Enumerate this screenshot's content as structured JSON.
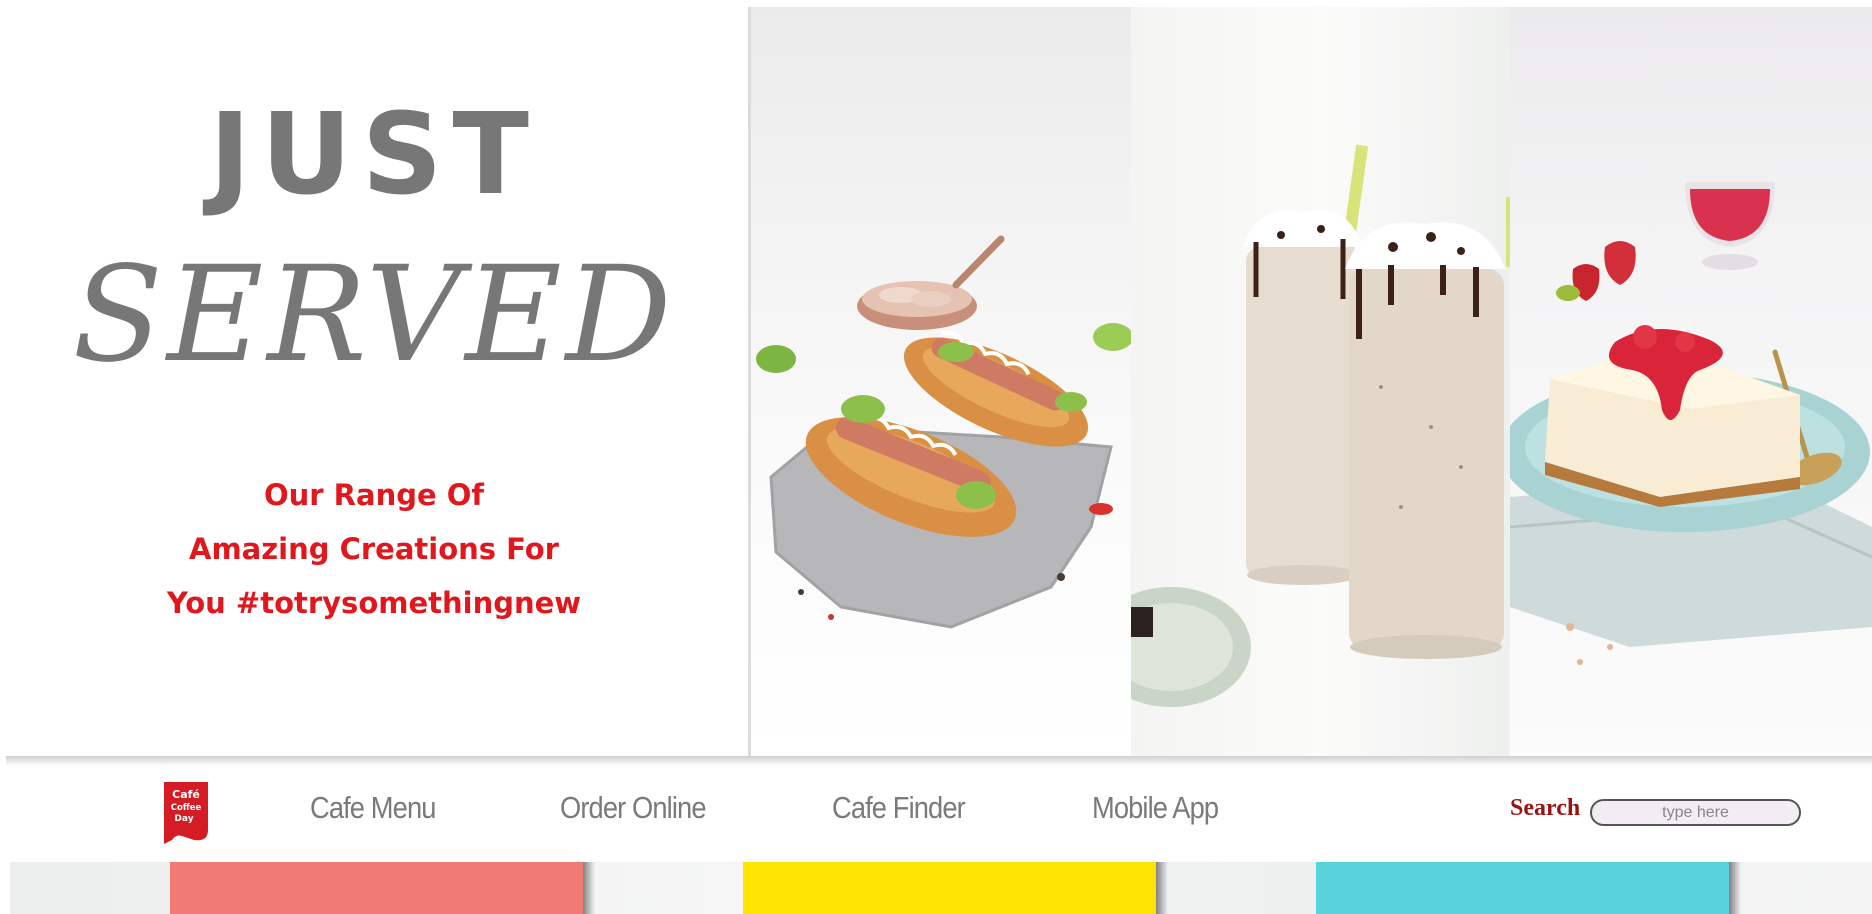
{
  "hero": {
    "title_line1": "JUST",
    "title_line2": "SERVED",
    "tagline": [
      "Our Range Of",
      "Amazing Creations For",
      "You #totrysomethingnew"
    ],
    "panels": [
      "croissant-hotdog-image",
      "frappe-shakes-image",
      "strawberry-cheesecake-image"
    ]
  },
  "nav": {
    "logo_icon": "cafe-coffee-day-logo",
    "links": [
      "Cafe Menu",
      "Order Online",
      "Cafe Finder",
      "Mobile App"
    ],
    "search_label": "Search",
    "search_placeholder": "type here"
  },
  "colors": {
    "title_gray": "#777777",
    "tagline_red": "#e0181d",
    "search_label": "#9a1313",
    "card_coral": "#f27a75",
    "card_yellow": "#ffe302",
    "card_teal": "#5ad2dc"
  }
}
